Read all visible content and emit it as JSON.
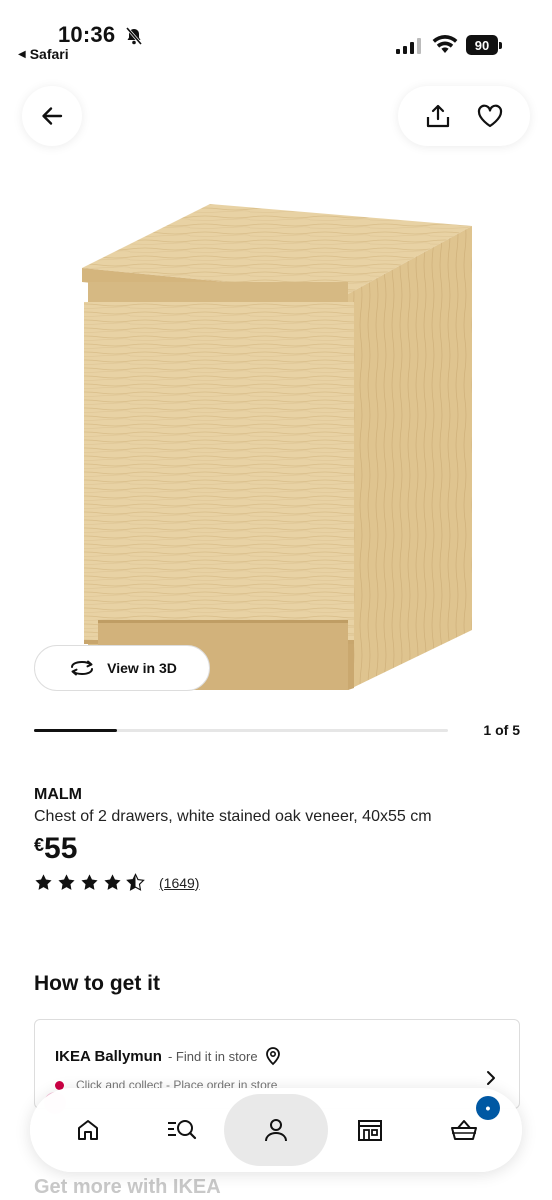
{
  "status_bar": {
    "time": "10:36",
    "back_app": "Safari",
    "battery": "90",
    "icons": [
      "bell-slash-icon",
      "signal-icon",
      "wifi-icon",
      "battery-icon"
    ]
  },
  "top_actions": {
    "icons": [
      "arrow-left-icon",
      "share-icon",
      "heart-icon"
    ]
  },
  "image": {
    "view3d_label": "View in 3D",
    "counter": "1 of 5",
    "progress": 0.2
  },
  "product": {
    "name": "MALM",
    "description": "Chest of 2 drawers, white stained oak veneer, 40x55 cm",
    "currency": "€",
    "price": "55",
    "rating": 4.5,
    "review_count": "(1649)"
  },
  "how_to_get": {
    "title": "How to get it",
    "store_name": "IKEA Ballymun",
    "store_hint": "- Find it in store",
    "collect_text": "Click and collect - Place order in store"
  },
  "more": {
    "title": "Get more with IKEA"
  },
  "bottom_nav": {
    "items": [
      "home-icon",
      "search-list-icon",
      "profile-icon",
      "store-icon",
      "basket-icon"
    ],
    "active": "profile-icon",
    "cart_badge": "•"
  },
  "colors": {
    "accent_blue": "#0058a3",
    "wood_light": "#e6cfa0",
    "wood_mid": "#d9bd86"
  }
}
